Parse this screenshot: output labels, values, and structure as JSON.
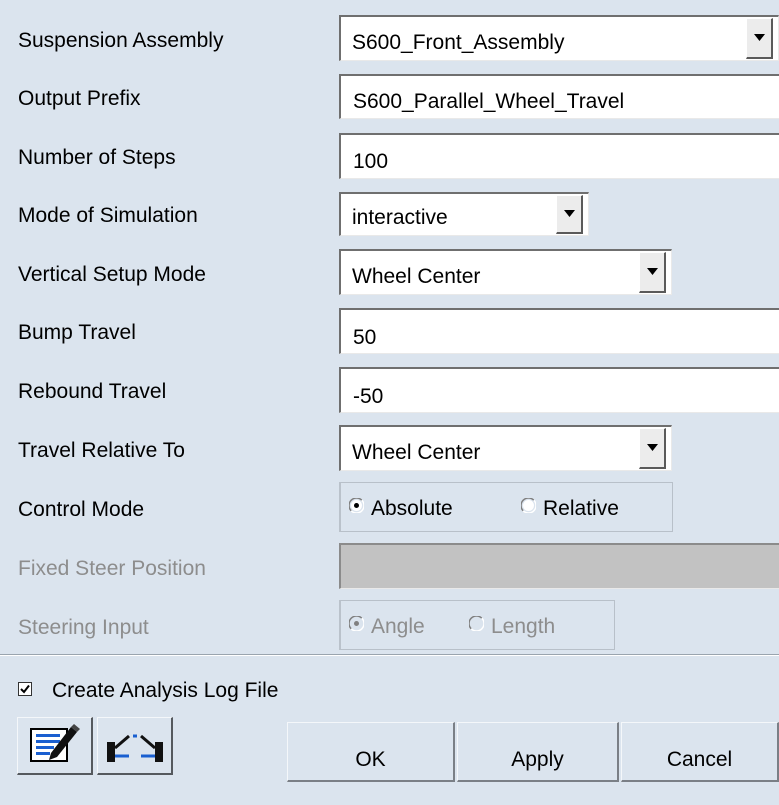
{
  "form": {
    "suspension_assembly": {
      "label": "Suspension Assembly",
      "value": "S600_Front_Assembly"
    },
    "output_prefix": {
      "label": "Output Prefix",
      "value": "S600_Parallel_Wheel_Travel"
    },
    "number_of_steps": {
      "label": "Number of Steps",
      "value": "100"
    },
    "mode_of_simulation": {
      "label": "Mode of Simulation",
      "value": "interactive"
    },
    "vertical_setup_mode": {
      "label": "Vertical Setup Mode",
      "value": "Wheel Center"
    },
    "bump_travel": {
      "label": "Bump Travel",
      "value": "50"
    },
    "rebound_travel": {
      "label": "Rebound Travel",
      "value": "-50"
    },
    "travel_relative_to": {
      "label": "Travel Relative To",
      "value": "Wheel Center"
    },
    "control_mode": {
      "label": "Control Mode",
      "options": [
        "Absolute",
        "Relative"
      ],
      "selected": "Absolute"
    },
    "fixed_steer_position": {
      "label": "Fixed Steer Position",
      "value": "",
      "disabled": true
    },
    "steering_input": {
      "label": "Steering Input",
      "options": [
        "Angle",
        "Length"
      ],
      "selected": "Angle",
      "disabled": true
    }
  },
  "log_file": {
    "label": "Create Analysis Log File",
    "checked": true
  },
  "toolbar": {
    "icons": [
      "data-navigator-icon",
      "wheel-travel-plot-icon"
    ]
  },
  "buttons": {
    "ok": "OK",
    "apply": "Apply",
    "cancel": "Cancel"
  },
  "colors": {
    "background": "#dbe4ee",
    "disabled_text": "#8d8d8d",
    "disabled_field": "#c2c2c2"
  }
}
